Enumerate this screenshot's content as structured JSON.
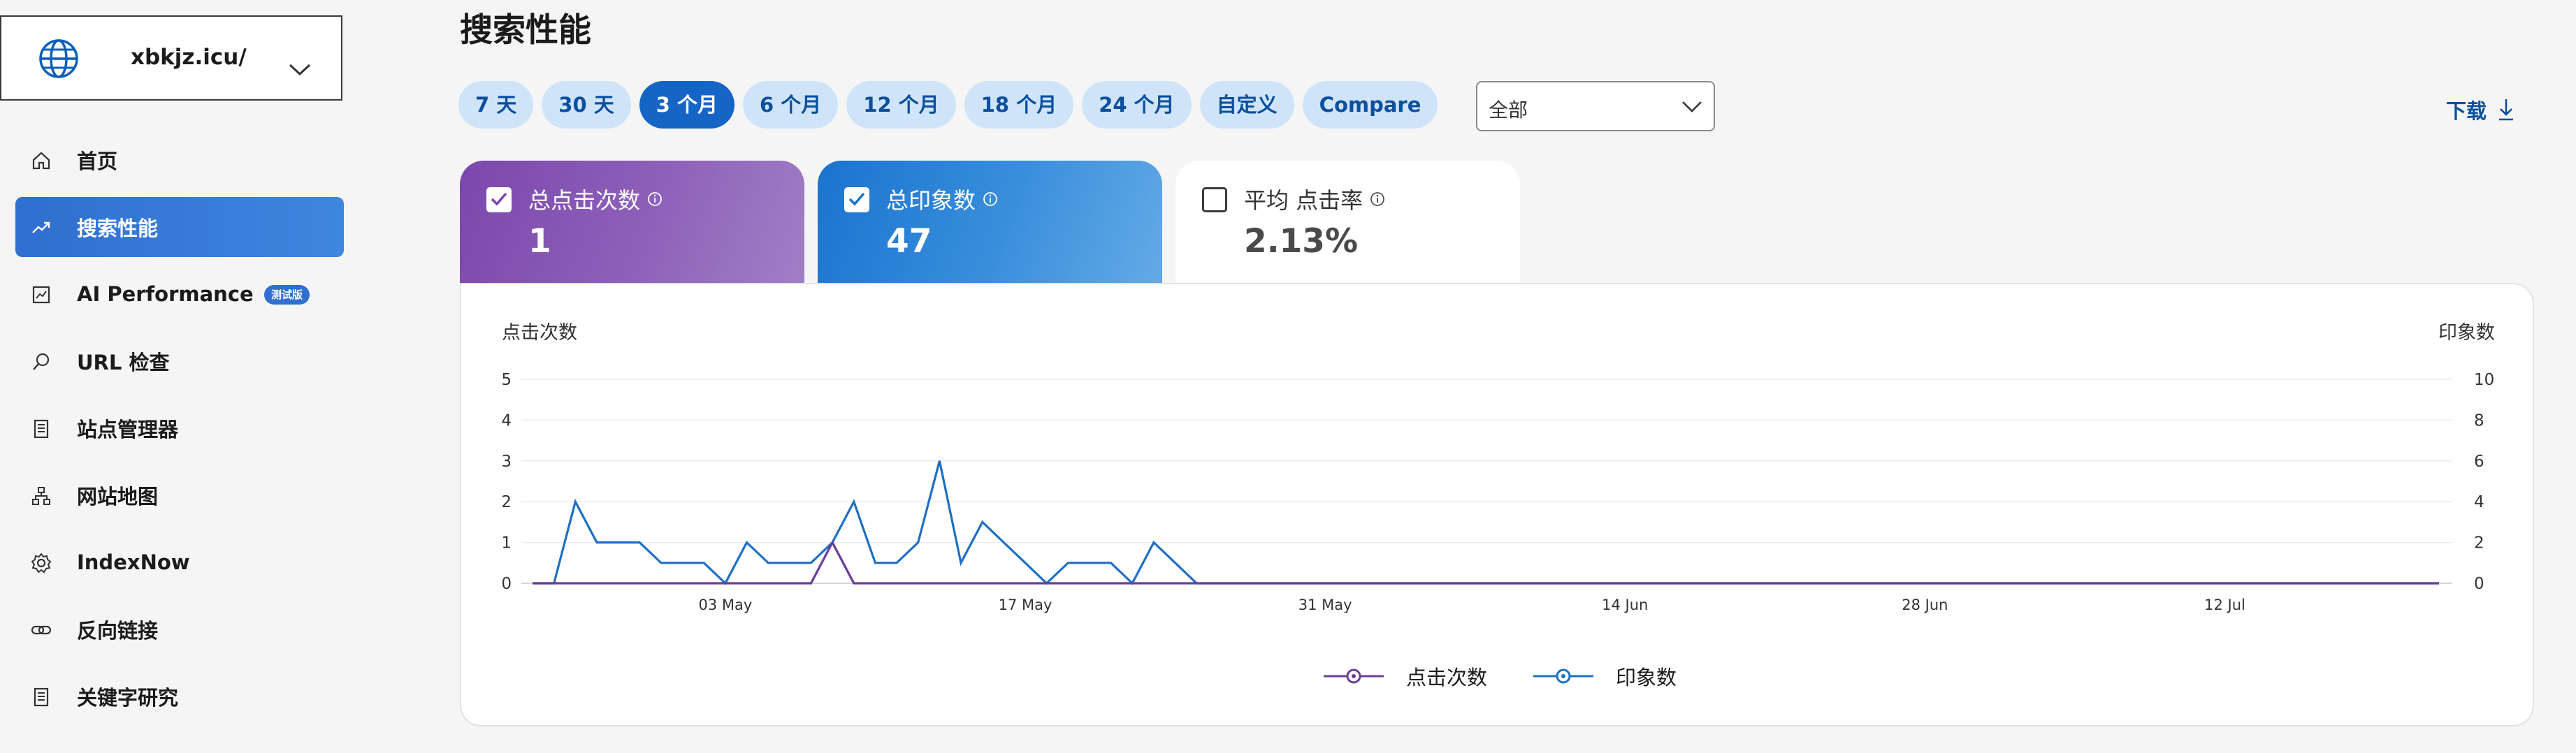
{
  "site_selector": {
    "site_name": "xbkjz.icu/",
    "icon": "globe-icon"
  },
  "sidebar": {
    "items": [
      {
        "label": "首页",
        "icon": "home-icon"
      },
      {
        "label": "搜索性能",
        "icon": "trend-icon",
        "active": true
      },
      {
        "label": "AI Performance",
        "icon": "ai-chart-icon",
        "badge": "测试版"
      },
      {
        "label": "URL 检查",
        "icon": "search-icon"
      },
      {
        "label": "站点管理器",
        "icon": "document-icon"
      },
      {
        "label": "网站地图",
        "icon": "sitemap-icon"
      },
      {
        "label": "IndexNow",
        "icon": "gear-icon"
      },
      {
        "label": "反向链接",
        "icon": "link-icon"
      },
      {
        "label": "关键字研究",
        "icon": "document-icon"
      }
    ]
  },
  "header": {
    "title": "搜索性能",
    "ranges": [
      "7 天",
      "30 天",
      "3 个月",
      "6 个月",
      "12 个月",
      "18 个月",
      "24 个月",
      "自定义",
      "Compare"
    ],
    "active_range": "3 个月",
    "filter_value": "全部",
    "download_label": "下载"
  },
  "metrics": {
    "clicks": {
      "label": "总点击次数",
      "value": "1",
      "checked": true,
      "color": "#7b47ad"
    },
    "impressions": {
      "label": "总印象数",
      "value": "47",
      "checked": true,
      "color": "#1a73cf"
    },
    "ctr": {
      "label": "平均 点击率",
      "value": "2.13%",
      "checked": false
    }
  },
  "chart_data": {
    "type": "line",
    "left_axis_label": "点击次数",
    "right_axis_label": "印象数",
    "left_ylim": [
      0,
      5
    ],
    "left_ticks": [
      0,
      1,
      2,
      3,
      4,
      5
    ],
    "right_ylim": [
      0,
      10
    ],
    "right_ticks": [
      0,
      2,
      4,
      6,
      8,
      10
    ],
    "x_tick_labels": [
      "03 May",
      "17 May",
      "31 May",
      "14 Jun",
      "28 Jun",
      "12 Jul"
    ],
    "x_tick_index": [
      9,
      23,
      37,
      51,
      65,
      79
    ],
    "num_days": 90,
    "grid": true,
    "legend_position": "bottom-center",
    "series": [
      {
        "name": "点击次数",
        "axis": "left",
        "color": "#6a3d9a",
        "values": [
          0,
          0,
          0,
          0,
          0,
          0,
          0,
          0,
          0,
          0,
          0,
          0,
          0,
          0,
          1,
          0,
          0,
          0,
          0,
          0,
          0,
          0,
          0,
          0,
          0,
          0,
          0,
          0,
          0,
          0,
          0,
          0,
          0,
          0,
          0,
          0,
          0,
          0,
          0,
          0,
          0,
          0,
          0,
          0,
          0,
          0,
          0,
          0,
          0,
          0,
          0,
          0,
          0,
          0,
          0,
          0,
          0,
          0,
          0,
          0,
          0,
          0,
          0,
          0,
          0,
          0,
          0,
          0,
          0,
          0,
          0,
          0,
          0,
          0,
          0,
          0,
          0,
          0,
          0,
          0,
          0,
          0,
          0,
          0,
          0,
          0,
          0,
          0,
          0,
          0
        ]
      },
      {
        "name": "印象数",
        "axis": "right",
        "color": "#1f6fc4",
        "values": [
          0,
          0,
          4,
          2,
          2,
          2,
          1,
          1,
          1,
          0,
          2,
          1,
          1,
          1,
          2,
          4,
          1,
          1,
          2,
          6,
          1,
          3,
          2,
          1,
          0,
          1,
          1,
          1,
          0,
          2,
          1,
          0,
          0,
          0,
          0,
          0,
          0,
          0,
          0,
          0,
          0,
          0,
          0,
          0,
          0,
          0,
          0,
          0,
          0,
          0,
          0,
          0,
          0,
          0,
          0,
          0,
          0,
          0,
          0,
          0,
          0,
          0,
          0,
          0,
          0,
          0,
          0,
          0,
          0,
          0,
          0,
          0,
          0,
          0,
          0,
          0,
          0,
          0,
          0,
          0,
          0,
          0,
          0,
          0,
          0,
          0,
          0,
          0,
          0,
          0
        ]
      }
    ]
  }
}
